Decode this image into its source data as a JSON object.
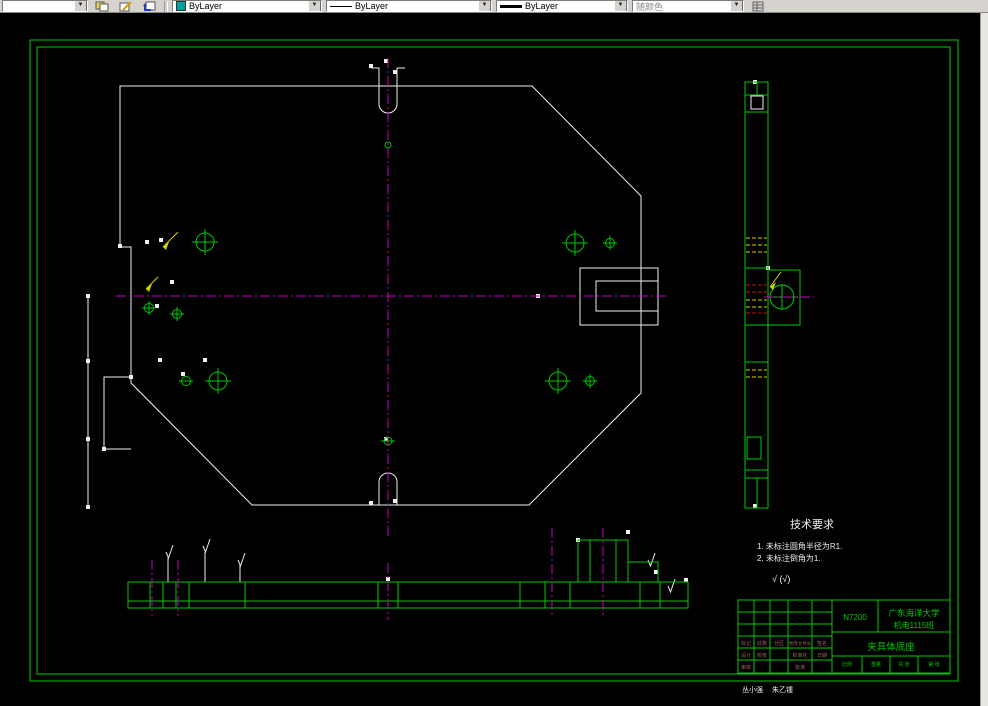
{
  "toolbar": {
    "color_value": "ByLayer",
    "linetype_value": "ByLayer",
    "lineweight_value": "ByLayer",
    "plotstyle_value": "随颜色"
  },
  "colors": {
    "white": "#f0f0f0",
    "green": "#00c800",
    "magenta": "#c800c8",
    "yellow": "#d2d200",
    "red": "#cc1111",
    "maroon": "#a06060"
  },
  "notes": {
    "title": "技术要求",
    "line1": "1. 未标注圆角半径为R1.",
    "line2": "2. 未标注倒角为1.",
    "finish": "√ (√)"
  },
  "title_block": {
    "drawing_no": "N7200",
    "school": "广东海洋大学",
    "class_name": "机电1115班",
    "part_name": "夹具体底座",
    "grid_row1": [
      "标记",
      "处数",
      "分区",
      "更改文件号",
      "签名"
    ],
    "grid_row2": [
      "设计",
      "校核",
      "标准化",
      "日期"
    ],
    "grid_row3": [
      "审核",
      "批准"
    ],
    "bottom_row": [
      "比例",
      "重量",
      "共 张",
      "第 张"
    ],
    "names": [
      "丛小强",
      "朱乙锺"
    ]
  }
}
